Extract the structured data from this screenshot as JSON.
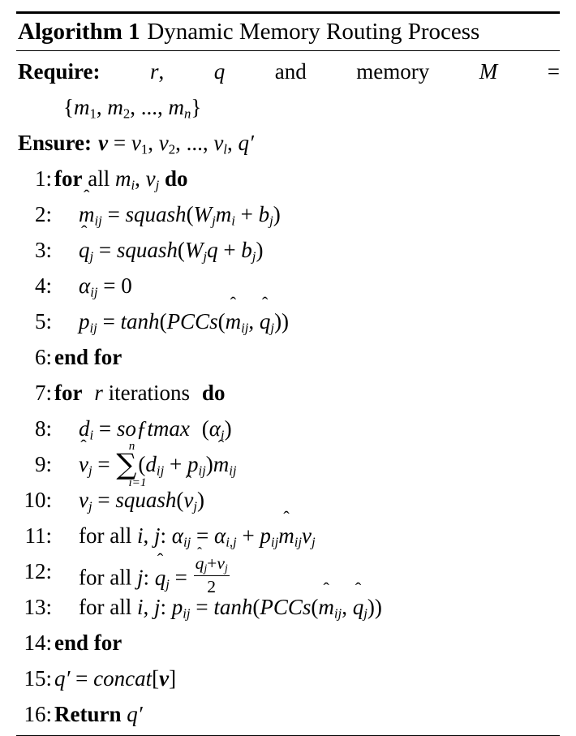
{
  "algorithm": {
    "label": "Algorithm 1",
    "title": "Dynamic Memory Routing Process",
    "require_label": "Require:",
    "ensure_label": "Ensure:",
    "require_tokens": [
      "r,",
      "q",
      "and",
      "memory",
      "M",
      "="
    ],
    "require_continuation": "{m1, m2, ..., mn}",
    "ensure_expression": "v = v1, v2, ..., vl, q'",
    "lines": [
      {
        "num": "1:",
        "indent": false,
        "text": "for all mi, vj do"
      },
      {
        "num": "2:",
        "indent": true,
        "text": "m̂ij = squash(Wj mi + bj)"
      },
      {
        "num": "3:",
        "indent": true,
        "text": "q̂j = squash(Wj q + bj)"
      },
      {
        "num": "4:",
        "indent": true,
        "text": "αij = 0"
      },
      {
        "num": "5:",
        "indent": true,
        "text": "pij = tanh(PCCs(m̂ij, q̂j))"
      },
      {
        "num": "6:",
        "indent": false,
        "text": "end for"
      },
      {
        "num": "7:",
        "indent": false,
        "text": "for r iterations do"
      },
      {
        "num": "8:",
        "indent": true,
        "text": "di = softmax (αi)"
      },
      {
        "num": "9:",
        "indent": true,
        "text": "v̂j = Σ(i=1..n) (dij + pij) m̂ij"
      },
      {
        "num": "10:",
        "indent": true,
        "text": "vj = squash(v̂j)"
      },
      {
        "num": "11:",
        "indent": true,
        "text": "for all i, j: αij = αi,j + pij m̂ij vj"
      },
      {
        "num": "12:",
        "indent": true,
        "text": "for all j: q̂j = (q̂j + vj) / 2"
      },
      {
        "num": "13:",
        "indent": true,
        "text": "for all i, j: pij = tanh(PCCs(m̂ij, q̂j))"
      },
      {
        "num": "14:",
        "indent": false,
        "text": "end for"
      },
      {
        "num": "15:",
        "indent": false,
        "text": "q' = concat[v]"
      },
      {
        "num": "16:",
        "indent": false,
        "text": "Return q'"
      }
    ],
    "keywords": {
      "for": "for",
      "all": "all",
      "do": "do",
      "end_for": "end for",
      "return": "Return",
      "iterations": "iterations",
      "for_all": "for all"
    },
    "functions": {
      "squash": "squash",
      "tanh": "tanh",
      "pccs": "PCCs",
      "softmax": "softmax",
      "concat": "concat"
    },
    "colors": {
      "rule": "#000000",
      "text": "#000000",
      "background": "#ffffff"
    }
  }
}
